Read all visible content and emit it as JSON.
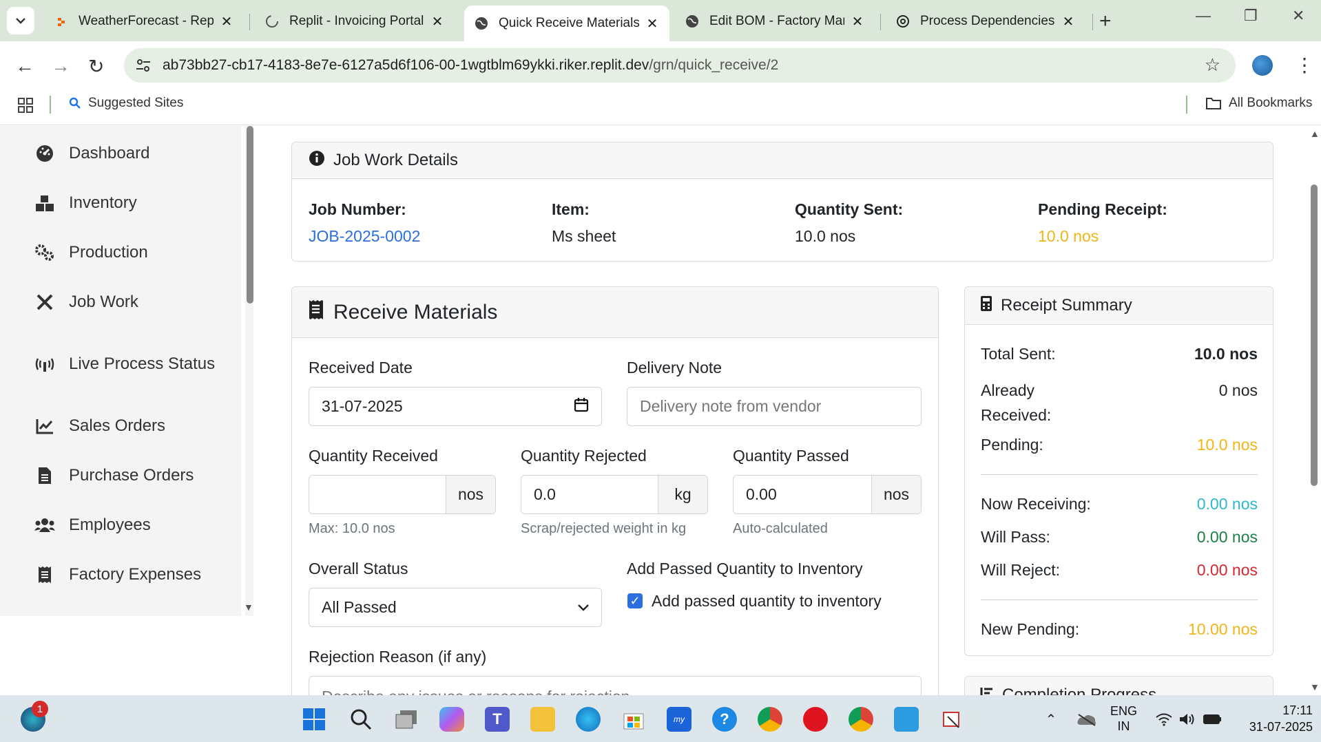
{
  "browser": {
    "tabs": [
      {
        "title": "WeatherForecast - Replit",
        "icon": "replit-icon"
      },
      {
        "title": "Replit - Invoicing Portal",
        "icon": "loading-icon"
      },
      {
        "title": "Quick Receive Materials -",
        "icon": "globe-icon",
        "active": true
      },
      {
        "title": "Edit BOM - Factory Mana",
        "icon": "globe-icon"
      },
      {
        "title": "Process Dependencies O",
        "icon": "openai-icon"
      }
    ],
    "url_host": "ab73bb27-cb17-4183-8e7e-6127a5d6f106-00-1wgtblm69ykki.riker.replit.dev",
    "url_path": "/grn/quick_receive/2",
    "bookmark_suggested": "Suggested Sites",
    "bookmark_all": "All Bookmarks"
  },
  "sidebar": {
    "items": [
      {
        "label": "Dashboard",
        "icon": "dashboard-icon"
      },
      {
        "label": "Inventory",
        "icon": "boxes-icon"
      },
      {
        "label": "Production",
        "icon": "gears-icon"
      },
      {
        "label": "Job Work",
        "icon": "tools-icon"
      },
      {
        "label": "Live Process Status",
        "icon": "broadcast-icon"
      },
      {
        "label": "Sales Orders",
        "icon": "chart-line-icon"
      },
      {
        "label": "Purchase Orders",
        "icon": "file-icon"
      },
      {
        "label": "Employees",
        "icon": "users-icon"
      },
      {
        "label": "Factory Expenses",
        "icon": "receipt-icon"
      }
    ]
  },
  "job_work": {
    "title": "Job Work Details",
    "job_number_label": "Job Number:",
    "job_number": "JOB-2025-0002",
    "item_label": "Item:",
    "item": "Ms sheet",
    "qty_sent_label": "Quantity Sent:",
    "qty_sent": "10.0 nos",
    "pending_label": "Pending Receipt:",
    "pending": "10.0 nos"
  },
  "receive": {
    "title": "Receive Materials",
    "received_date_label": "Received Date",
    "received_date": "31-07-2025",
    "delivery_note_label": "Delivery Note",
    "delivery_note_placeholder": "Delivery note from vendor",
    "qty_received_label": "Quantity Received",
    "qty_received_value": "",
    "qty_received_unit": "nos",
    "qty_received_help": "Max: 10.0 nos",
    "qty_rejected_label": "Quantity Rejected",
    "qty_rejected_value": "0.0",
    "qty_rejected_unit": "kg",
    "qty_rejected_help": "Scrap/rejected weight in kg",
    "qty_passed_label": "Quantity Passed",
    "qty_passed_value": "0.00",
    "qty_passed_unit": "nos",
    "qty_passed_help": "Auto-calculated",
    "overall_status_label": "Overall Status",
    "overall_status_value": "All Passed",
    "add_inventory_label": "Add Passed Quantity to Inventory",
    "add_inventory_checkbox": "Add passed quantity to inventory",
    "add_inventory_checked": true,
    "rejection_reason_label": "Rejection Reason (if any)",
    "rejection_reason_placeholder": "Describe any issues or reasons for rejection..."
  },
  "summary": {
    "title": "Receipt Summary",
    "total_sent_label": "Total Sent:",
    "total_sent": "10.0 nos",
    "already_received_label_1": "Already",
    "already_received_label_2": "Received:",
    "already_received": "0 nos",
    "pending_label": "Pending:",
    "pending": "10.0 nos",
    "now_receiving_label": "Now Receiving:",
    "now_receiving": "0.00 nos",
    "will_pass_label": "Will Pass:",
    "will_pass": "0.00 nos",
    "will_reject_label": "Will Reject:",
    "will_reject": "0.00 nos",
    "new_pending_label": "New Pending:",
    "new_pending": "10.00 nos"
  },
  "completion": {
    "title": "Completion Progress"
  },
  "taskbar": {
    "notification_count": "1",
    "lang_1": "ENG",
    "lang_2": "IN",
    "time": "17:11",
    "date": "31-07-2025"
  },
  "colors": {
    "link": "#2a6ee0",
    "warning": "#f2b518",
    "info": "#2cb8d0",
    "success": "#1c8146",
    "danger": "#d9272f"
  }
}
